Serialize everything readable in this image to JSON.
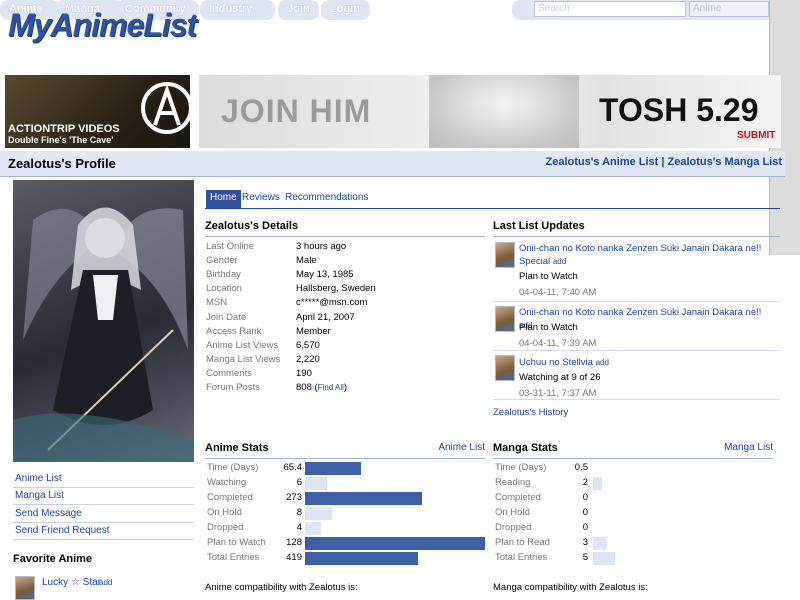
{
  "nav": {
    "tabs": [
      "Anime",
      "Manga",
      "Community",
      "Industry",
      "Join",
      "Login"
    ],
    "search": {
      "placeholder": "Search",
      "type": "Anime",
      "go_icon": "down-arrow-icon"
    }
  },
  "logo": "MyAnimeList",
  "ads": {
    "left": {
      "title": "ACTIONTRIP VIDEOS",
      "subtitle": "Double Fine's 'The Cave'"
    },
    "right": {
      "headline": "JOIN HIM",
      "brand": "TOSH 5.29",
      "submit": "SUBMIT"
    }
  },
  "profile": {
    "title": "Zealotus's Profile",
    "anime_list_link": "Zealotus's Anime List",
    "manga_list_link": "Zealotus's Manga List",
    "separator": "|"
  },
  "sidebar": {
    "links": [
      "Anime List",
      "Manga List",
      "Send Message",
      "Send Friend Request"
    ],
    "favorites_heading": "Favorite Anime",
    "favorite": {
      "title": "Lucky ☆ Star",
      "add": "add"
    }
  },
  "tabs": [
    {
      "label": "Home",
      "active": true
    },
    {
      "label": "Reviews",
      "active": false
    },
    {
      "label": "Recommendations",
      "active": false
    }
  ],
  "details": {
    "heading": "Zealotus's Details",
    "rows": [
      {
        "label": "Last Online",
        "value": "3 hours ago"
      },
      {
        "label": "Gender",
        "value": "Male"
      },
      {
        "label": "Birthday",
        "value": "May 13, 1985"
      },
      {
        "label": "Location",
        "value": "Hallsberg, Sweden"
      },
      {
        "label": "MSN",
        "value": "c*****@msn.com"
      },
      {
        "label": "Join Date",
        "value": "April 21, 2007"
      },
      {
        "label": "Access Rank",
        "value": "Member"
      },
      {
        "label": "Anime List Views",
        "value": "6,570"
      },
      {
        "label": "Manga List Views",
        "value": "2,220"
      },
      {
        "label": "Comments",
        "value": "190"
      },
      {
        "label": "Forum Posts",
        "value": "808"
      }
    ],
    "find_all": "Find All",
    "find_all_open": "(",
    "find_all_close": ")"
  },
  "updates": {
    "heading": "Last List Updates",
    "items": [
      {
        "title": "Onii-chan no Koto nanka Zenzen Suki Janain Dakara ne!! Special",
        "add": "add",
        "status": "Plan to Watch",
        "date": "04-04-11, 7:40 AM"
      },
      {
        "title": "Onii-chan no Koto nanka Zenzen Suki Janain Dakara ne!!",
        "add": "add",
        "status": "Plan to Watch",
        "date": "04-04-11, 7:39 AM"
      },
      {
        "title": "Uchuu no Stellvia",
        "add": "add",
        "status": "Watching at 9 of 26",
        "date": "03-31-11, 7:37 AM"
      }
    ],
    "history": "Zealotus's History"
  },
  "anime_stats": {
    "heading": "Anime Stats",
    "link": "Anime List",
    "rows": [
      {
        "label": "Time (Days)",
        "value": "65.4",
        "fill": 0.31
      },
      {
        "label": "Watching",
        "value": "6",
        "fill": 0.12
      },
      {
        "label": "Completed",
        "value": "273",
        "fill": 0.65
      },
      {
        "label": "On Hold",
        "value": "8",
        "fill": 0.15
      },
      {
        "label": "Dropped",
        "value": "4",
        "fill": 0.09
      },
      {
        "label": "Plan to Watch",
        "value": "128",
        "fill": 1.0
      },
      {
        "label": "Total Entries",
        "value": "419",
        "fill": 0.63
      }
    ],
    "compat": "Anime compatibility with Zealotus is:"
  },
  "manga_stats": {
    "heading": "Manga Stats",
    "link": "Manga List",
    "rows": [
      {
        "label": "Time (Days)",
        "value": "0.5",
        "fill": 0.0
      },
      {
        "label": "Reading",
        "value": "2",
        "fill": 0.05
      },
      {
        "label": "Completed",
        "value": "0",
        "fill": 0.0
      },
      {
        "label": "On Hold",
        "value": "0",
        "fill": 0.0
      },
      {
        "label": "Dropped",
        "value": "0",
        "fill": 0.0
      },
      {
        "label": "Plan to Read",
        "value": "3",
        "fill": 0.08
      },
      {
        "label": "Total Entries",
        "value": "5",
        "fill": 0.12
      }
    ],
    "compat": "Manga compatibility with Zealotus is:"
  },
  "colors": {
    "brand": "#2e51a2",
    "link": "#1c439b",
    "bar_fill": "#3d5fa8",
    "bar_bg": "#dce5f4"
  }
}
